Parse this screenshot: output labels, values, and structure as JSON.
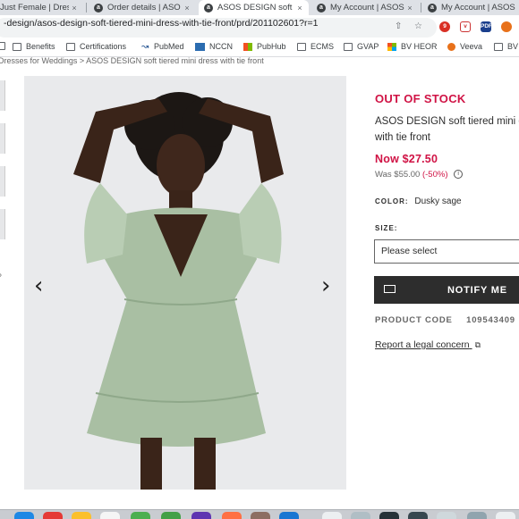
{
  "browser": {
    "tabs": [
      {
        "title": "Just Female | Dres",
        "icon": "asos-favicon"
      },
      {
        "title": "Order details | ASO",
        "icon": "asos-favicon"
      },
      {
        "title": "ASOS DESIGN soft",
        "icon": "asos-favicon",
        "active": true
      },
      {
        "title": "My Account | ASOS",
        "icon": "asos-favicon"
      },
      {
        "title": "My Account | ASOS",
        "icon": "asos-favicon"
      }
    ],
    "close_glyph": "×",
    "url_host": "-design/asos-design-soft-tiered-mini-dress-with-tie-front/prd/201102601?r=1",
    "bookmarks": [
      {
        "label": "Benefits",
        "icon": "folder-icon"
      },
      {
        "label": "Certifications",
        "icon": "folder-icon"
      },
      {
        "label": "PubMed",
        "icon": "pubmed-icon"
      },
      {
        "label": "NCCN",
        "icon": "nccn-icon"
      },
      {
        "label": "PubHub",
        "icon": "pubhub-icon"
      },
      {
        "label": "ECMS",
        "icon": "folder-icon"
      },
      {
        "label": "GVAP",
        "icon": "folder-icon"
      },
      {
        "label": "BV HEOR",
        "icon": "windows-icon"
      },
      {
        "label": "Veeva",
        "icon": "veeva-icon"
      },
      {
        "label": "BV",
        "icon": "folder-icon"
      }
    ],
    "ext_pdf_label": "PDF"
  },
  "page": {
    "breadcrumb": "Dresses for Weddings  >  ASOS DESIGN soft tiered mini dress with tie front",
    "stock_status": "OUT OF STOCK",
    "product_title": "ASOS DESIGN soft tiered mini dress with tie front",
    "price_now": "Now $27.50",
    "price_was": "Was $55.00",
    "discount": "(-50%)",
    "color_label": "COLOR:",
    "color_value": "Dusky sage",
    "size_label": "SIZE:",
    "size_placeholder": "Please select",
    "notify_label": "NOTIFY ME",
    "product_code_label": "PRODUCT CODE",
    "product_code": "109543409",
    "legal_link": "Report a legal concern",
    "prev_arrow": "‹",
    "next_arrow": "›"
  },
  "colors": {
    "accent_red": "#d01345",
    "dark": "#2d2d2d",
    "dress_sage": "#a9bfa3"
  }
}
